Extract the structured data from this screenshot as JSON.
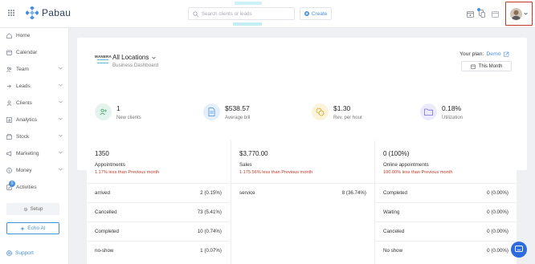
{
  "brand": {
    "name": "Pabau",
    "accent": "#4a90d9"
  },
  "search": {
    "placeholder": "Search clients or leads"
  },
  "header": {
    "create_label": "Create"
  },
  "sidebar": {
    "items": [
      {
        "label": "Home",
        "icon": "home-icon"
      },
      {
        "label": "Calendar",
        "icon": "calendar-icon"
      },
      {
        "label": "Team",
        "icon": "team-icon"
      },
      {
        "label": "Leads",
        "icon": "leads-icon"
      },
      {
        "label": "Clients",
        "icon": "clients-icon"
      },
      {
        "label": "Analytics",
        "icon": "analytics-icon"
      },
      {
        "label": "Stock",
        "icon": "stock-icon"
      },
      {
        "label": "Marketing",
        "icon": "marketing-icon"
      },
      {
        "label": "Money",
        "icon": "money-icon"
      },
      {
        "label": "Activities",
        "icon": "activities-icon",
        "badge": "0"
      }
    ],
    "setup_label": "Setup",
    "echo_label": "Echo AI",
    "support_label": "Support"
  },
  "dashboard": {
    "logo_text": "MANERA",
    "location": "All Locations",
    "subtitle": "Business Dashboard",
    "plan_label": "Your plan:",
    "plan_value": "Demo",
    "period": "This Month"
  },
  "kpis": [
    {
      "value": "1",
      "label": "New clients",
      "icon": "user-plus-icon",
      "color": "#e3f4ec"
    },
    {
      "value": "$538.57",
      "label": "Average bill",
      "icon": "receipt-icon",
      "color": "#e3effb"
    },
    {
      "value": "$1.30",
      "label": "Rev. per hour",
      "icon": "coins-icon",
      "color": "#fbf3da"
    },
    {
      "value": "0.18%",
      "label": "Utilization",
      "icon": "folder-icon",
      "color": "#ecebfb"
    }
  ],
  "stats": [
    {
      "value": "1350",
      "label": "Appointments",
      "change": "1.17% less than Previous month",
      "rows": [
        {
          "name": "arrived",
          "value": "2 (0.15%)"
        },
        {
          "name": "Cancelled",
          "value": "73 (5.41%)"
        },
        {
          "name": "Completed",
          "value": "10 (0.74%)"
        },
        {
          "name": "no-show",
          "value": "1 (0.07%)"
        }
      ]
    },
    {
      "value": "$3,770.00",
      "label": "Sales",
      "change": "1.175.56% less than Previous month",
      "rows": [
        {
          "name": "service",
          "value": "8 (36.74%)"
        }
      ]
    },
    {
      "value": "0 (100%)",
      "label": "Online appointments",
      "change": "100.00% less than Previous month",
      "rows": [
        {
          "name": "Completed",
          "value": "0 (0.00%)"
        },
        {
          "name": "Waiting",
          "value": "0 (0.00%)"
        },
        {
          "name": "Canceled",
          "value": "0 (0.00%)"
        },
        {
          "name": "No show",
          "value": "0 (0.00%)"
        }
      ]
    }
  ]
}
